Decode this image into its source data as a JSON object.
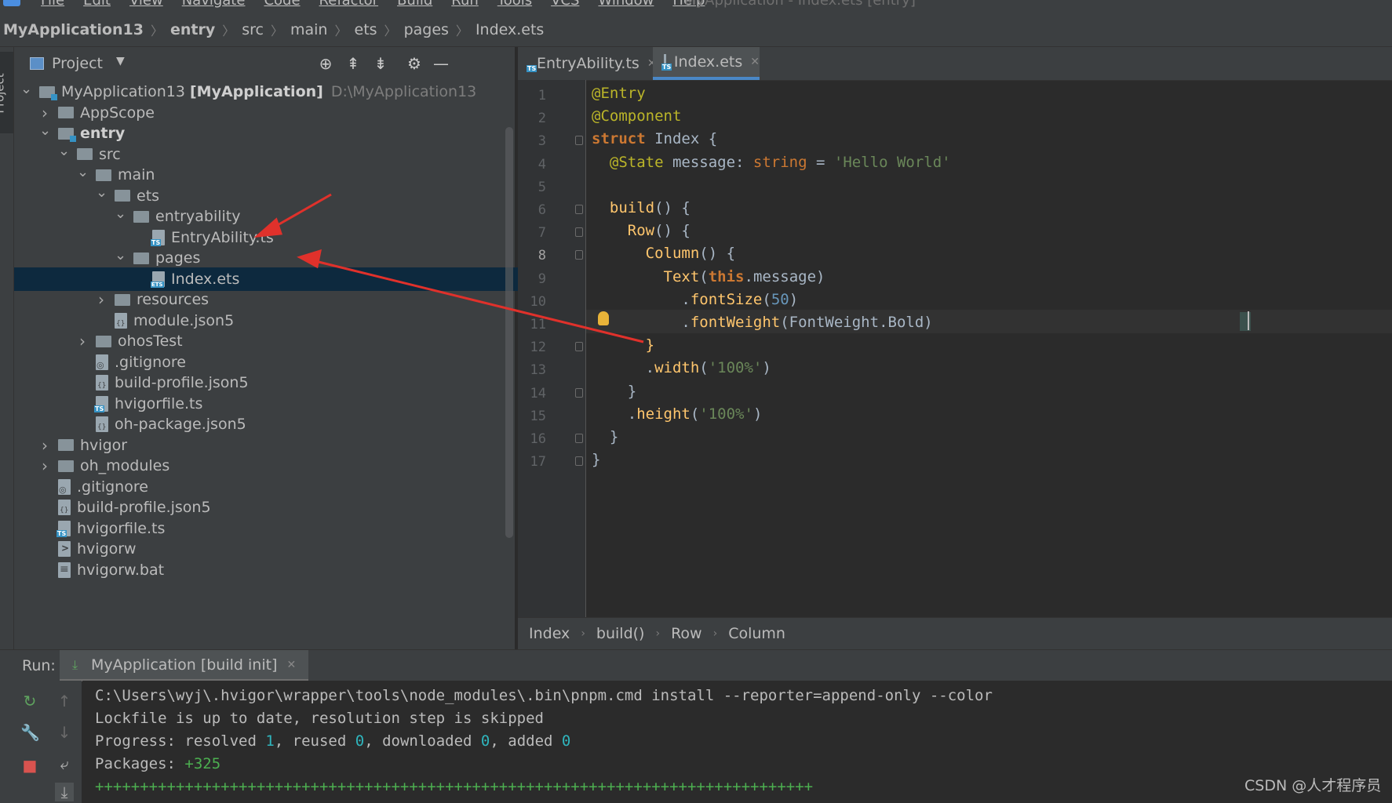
{
  "menubar": {
    "items": [
      "File",
      "Edit",
      "View",
      "Navigate",
      "Code",
      "Refactor",
      "Build",
      "Run",
      "Tools",
      "VCS",
      "Window",
      "Help"
    ],
    "window_title": "MyApplication - Index.ets [entry]"
  },
  "breadcrumb": [
    "MyApplication13",
    "entry",
    "src",
    "main",
    "ets",
    "pages",
    "Index.ets"
  ],
  "stripe": {
    "project_label": "Project"
  },
  "project_panel": {
    "title": "Project",
    "tree": [
      {
        "label": "MyApplication13",
        "bold_suffix": "[MyApplication]",
        "extra": "D:\\MyApplication13",
        "type": "folder-mod",
        "arrow": "open"
      },
      {
        "label": "AppScope",
        "type": "folder",
        "arrow": "closed"
      },
      {
        "label": "entry",
        "type": "folder-mod",
        "arrow": "open",
        "bold": true
      },
      {
        "label": "src",
        "type": "folder",
        "arrow": "open"
      },
      {
        "label": "main",
        "type": "folder",
        "arrow": "open"
      },
      {
        "label": "ets",
        "type": "folder",
        "arrow": "open"
      },
      {
        "label": "entryability",
        "type": "folder",
        "arrow": "open"
      },
      {
        "label": "EntryAbility.ts",
        "type": "file-ts"
      },
      {
        "label": "pages",
        "type": "folder",
        "arrow": "open"
      },
      {
        "label": "Index.ets",
        "type": "file-ets",
        "selected": true
      },
      {
        "label": "resources",
        "type": "folder",
        "arrow": "closed"
      },
      {
        "label": "module.json5",
        "type": "file-json"
      },
      {
        "label": "ohosTest",
        "type": "folder",
        "arrow": "closed"
      },
      {
        "label": ".gitignore",
        "type": "file-git"
      },
      {
        "label": "build-profile.json5",
        "type": "file-json"
      },
      {
        "label": "hvigorfile.ts",
        "type": "file-ts"
      },
      {
        "label": "oh-package.json5",
        "type": "file-json"
      },
      {
        "label": "hvigor",
        "type": "folder",
        "arrow": "closed"
      },
      {
        "label": "oh_modules",
        "type": "folder",
        "arrow": "closed"
      },
      {
        "label": ".gitignore",
        "type": "file-git"
      },
      {
        "label": "build-profile.json5",
        "type": "file-json"
      },
      {
        "label": "hvigorfile.ts",
        "type": "file-ts"
      },
      {
        "label": "hvigorw",
        "type": "file-exe"
      },
      {
        "label": "hvigorw.bat",
        "type": "file-bat"
      }
    ]
  },
  "editor": {
    "tabs": [
      {
        "label": "EntryAbility.ts",
        "active": false
      },
      {
        "label": "Index.ets",
        "active": true
      }
    ],
    "line_numbers": [
      "1",
      "2",
      "3",
      "4",
      "5",
      "6",
      "7",
      "8",
      "9",
      "10",
      "11",
      "12",
      "13",
      "14",
      "15",
      "16",
      "17"
    ],
    "current_line": 8,
    "code_lines": [
      [
        [
          "c-ann",
          "@Entry"
        ]
      ],
      [
        [
          "c-ann",
          "@Component"
        ]
      ],
      [
        [
          "c-kw",
          "struct "
        ],
        [
          "c-cls",
          "Index "
        ],
        [
          "c-plain",
          "{"
        ]
      ],
      [
        [
          "c-plain",
          "  "
        ],
        [
          "c-ann",
          "@State "
        ],
        [
          "c-plain",
          "message: "
        ],
        [
          "c-type",
          "string "
        ],
        [
          "c-plain",
          "= "
        ],
        [
          "c-str",
          "'Hello World'"
        ]
      ],
      [],
      [
        [
          "c-plain",
          "  "
        ],
        [
          "c-fn",
          "build"
        ],
        [
          "c-plain",
          "() {"
        ]
      ],
      [
        [
          "c-plain",
          "    "
        ],
        [
          "c-fn",
          "Row"
        ],
        [
          "c-plain",
          "() {"
        ]
      ],
      [
        [
          "c-plain",
          "      "
        ],
        [
          "c-fn",
          "Column"
        ],
        [
          "c-plain",
          "() {"
        ]
      ],
      [
        [
          "c-plain",
          "        "
        ],
        [
          "c-fn",
          "Text"
        ],
        [
          "c-plain",
          "("
        ],
        [
          "c-kw",
          "this"
        ],
        [
          "c-plain",
          ".message)"
        ]
      ],
      [
        [
          "c-plain",
          "          ."
        ],
        [
          "c-fn",
          "fontSize"
        ],
        [
          "c-plain",
          "("
        ],
        [
          "c-num",
          "50"
        ],
        [
          "c-plain",
          ")"
        ]
      ],
      [
        [
          "c-plain",
          "          ."
        ],
        [
          "c-fn",
          "fontWeight"
        ],
        [
          "c-plain",
          "(FontWeight.Bold)"
        ]
      ],
      [
        [
          "c-plain",
          "      "
        ],
        [
          "c-bld",
          "}"
        ]
      ],
      [
        [
          "c-plain",
          "      ."
        ],
        [
          "c-fn",
          "width"
        ],
        [
          "c-plain",
          "("
        ],
        [
          "c-str",
          "'100%'"
        ],
        [
          "c-plain",
          ")"
        ]
      ],
      [
        [
          "c-plain",
          "    }"
        ]
      ],
      [
        [
          "c-plain",
          "    ."
        ],
        [
          "c-fn",
          "height"
        ],
        [
          "c-plain",
          "("
        ],
        [
          "c-str",
          "'100%'"
        ],
        [
          "c-plain",
          ")"
        ]
      ],
      [
        [
          "c-plain",
          "  }"
        ]
      ],
      [
        [
          "c-plain",
          "}"
        ]
      ]
    ],
    "breadcrumb": [
      "Index",
      "build()",
      "Row",
      "Column"
    ]
  },
  "run_panel": {
    "label": "Run:",
    "tab_label": "MyApplication [build init]",
    "console_lines": [
      [
        [
          "",
          "C:\\Users\\wyj\\.hvigor\\wrapper\\tools\\node_modules\\.bin\\pnpm.cmd install --reporter=append-only --color"
        ]
      ],
      [
        [
          "",
          "Lockfile is up to date, resolution step is skipped"
        ]
      ],
      [
        [
          "",
          "Progress: resolved "
        ],
        [
          "con-num",
          "1"
        ],
        [
          "",
          ", reused "
        ],
        [
          "con-num",
          "0"
        ],
        [
          "",
          ", downloaded "
        ],
        [
          "con-num",
          "0"
        ],
        [
          "",
          ", added "
        ],
        [
          "con-num",
          "0"
        ]
      ],
      [
        [
          "",
          "Packages: "
        ],
        [
          "con-pkg",
          "+325"
        ]
      ],
      [
        [
          "con-plus",
          "++++++++++++++++++++++++++++++++++++++++++++++++++++++++++++++++++++++++++++++++"
        ]
      ]
    ]
  },
  "watermark": "CSDN @人才程序员",
  "colors": {
    "background": "#2b2b2b",
    "panel": "#3c3f41",
    "selection": "#0d293e",
    "accent": "#4a88c7",
    "arrow_red": "#e0312b"
  },
  "icons": [
    "project-window-icon",
    "locate-icon",
    "expand-all-icon",
    "collapse-all-icon",
    "settings-icon",
    "hide-icon",
    "rerun-icon",
    "wrench-icon",
    "stop-icon",
    "up-icon",
    "down-icon",
    "soft-wrap-icon",
    "scroll-to-end-icon",
    "bulb-icon"
  ]
}
